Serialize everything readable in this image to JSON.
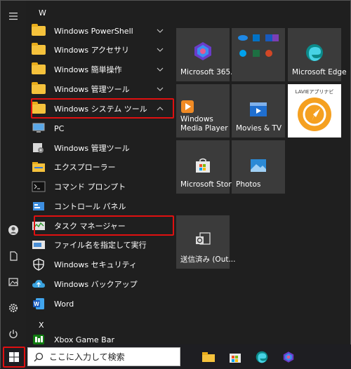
{
  "app_list": {
    "section_w": "W",
    "section_x": "X",
    "items": [
      {
        "label": "Windows PowerShell"
      },
      {
        "label": "Windows アクセサリ"
      },
      {
        "label": "Windows 簡単操作"
      },
      {
        "label": "Windows 管理ツール"
      },
      {
        "label": "Windows システム ツール"
      },
      {
        "label": "PC"
      },
      {
        "label": "Windows 管理ツール"
      },
      {
        "label": "エクスプローラー"
      },
      {
        "label": "コマンド プロンプト"
      },
      {
        "label": "コントロール パネル"
      },
      {
        "label": "タスク マネージャー"
      },
      {
        "label": "ファイル名を指定して実行"
      },
      {
        "label": "Windows セキュリティ"
      },
      {
        "label": "Windows バックアップ"
      },
      {
        "label": "Word"
      },
      {
        "label": "Xbox Game Bar"
      }
    ]
  },
  "tiles": {
    "m365": "Microsoft 365...",
    "edge": "Microsoft Edge",
    "wmp": "Windows\nMedia Player",
    "movies": "Movies & TV",
    "lavie": "LAVIEアプリナビ",
    "store": "Microsoft Store",
    "photos": "Photos",
    "outlook": "送信済み (Out..."
  },
  "taskbar": {
    "search_placeholder": "ここに入力して検索"
  },
  "colors": {
    "highlight": "#e01010",
    "folder": "#f5c23c",
    "tile_bg": "#3b3b3b"
  }
}
